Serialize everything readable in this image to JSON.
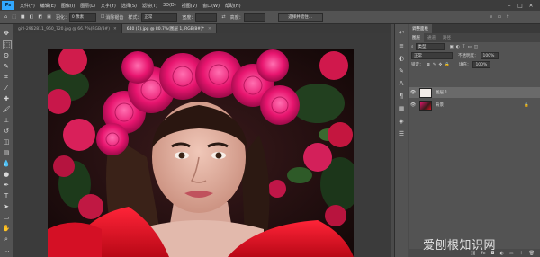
{
  "menubar": {
    "logo": "Ps",
    "items": [
      "文件(F)",
      "编辑(E)",
      "图像(I)",
      "图层(L)",
      "文字(Y)",
      "选择(S)",
      "滤镜(T)",
      "3D(D)",
      "视图(V)",
      "窗口(W)",
      "帮助(H)"
    ]
  },
  "options": {
    "feather_label": "羽化：",
    "feather_value": "0 像素",
    "antialias_label": "消除锯齿",
    "style_label": "样式：",
    "style_value": "正常",
    "width_label": "宽度：",
    "height_label": "高度：",
    "select_mask_button": "选择并遮住..."
  },
  "tabs": [
    {
      "label": "girl-2962811_960_720.jpg @ 66.7%(RGB/8#)"
    },
    {
      "label": "640 (1).jpg @ 80.7%(图层 1, RGB/8#)*"
    }
  ],
  "panel": {
    "tabs": [
      "图层",
      "通道",
      "路径"
    ],
    "top_tab": "调整面板",
    "kind_label": "类型",
    "blend_mode": "正常",
    "opacity_label": "不透明度：",
    "opacity_value": "100%",
    "lock_label": "锁定：",
    "fill_label": "填充：",
    "fill_value": "100%",
    "layers": [
      {
        "name": "图层 1",
        "selected": true
      },
      {
        "name": "背景",
        "selected": false
      }
    ]
  },
  "watermark": "爱刨根知识网",
  "colors": {
    "accent": "#31a8ff",
    "rose": "#e8156f",
    "dress": "#e0102a"
  }
}
